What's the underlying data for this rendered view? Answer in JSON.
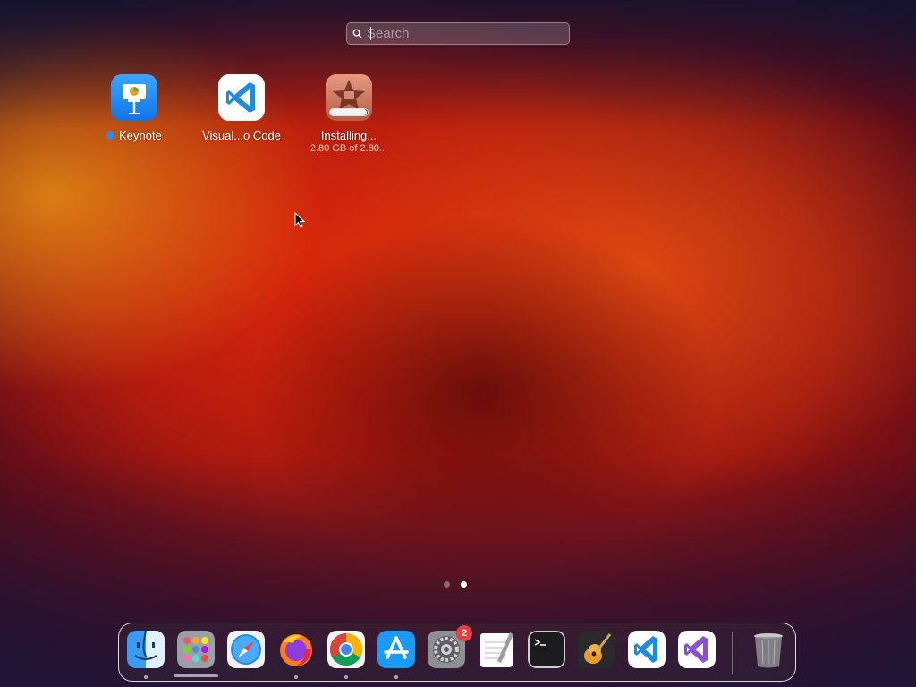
{
  "search": {
    "placeholder": "Search"
  },
  "apps": [
    {
      "name": "Keynote",
      "new": true,
      "icon": "keynote-icon"
    },
    {
      "name": "Visual...o Code",
      "icon": "vscode-icon"
    },
    {
      "name": "Installing...",
      "status": "2.80 GB of 2.80...",
      "progress": 0.98,
      "icon": "imovie-icon"
    }
  ],
  "pages": {
    "count": 2,
    "current": 2
  },
  "dock": {
    "items": [
      {
        "name": "Finder",
        "icon": "finder-icon",
        "running": true
      },
      {
        "name": "Launchpad",
        "icon": "launchpad-icon",
        "running": true
      },
      {
        "name": "Safari",
        "icon": "safari-icon",
        "running": false
      },
      {
        "name": "Firefox",
        "icon": "firefox-icon",
        "running": true
      },
      {
        "name": "Google Chrome",
        "icon": "chrome-icon",
        "running": true
      },
      {
        "name": "App Store",
        "icon": "app-store-icon",
        "running": true
      },
      {
        "name": "System Settings",
        "icon": "system-settings-icon",
        "badge": "2"
      },
      {
        "name": "TextEdit",
        "icon": "textedit-icon"
      },
      {
        "name": "Terminal",
        "icon": "terminal-icon"
      },
      {
        "name": "GarageBand",
        "icon": "garageband-icon"
      },
      {
        "name": "Visual Studio Code",
        "icon": "vscode-icon"
      },
      {
        "name": "Visual Studio",
        "icon": "visual-studio-icon"
      },
      {
        "name": "Trash",
        "icon": "trash-icon"
      }
    ]
  },
  "colors": {
    "accent": "#2c8cf0",
    "badge": "#ee3b3b"
  }
}
